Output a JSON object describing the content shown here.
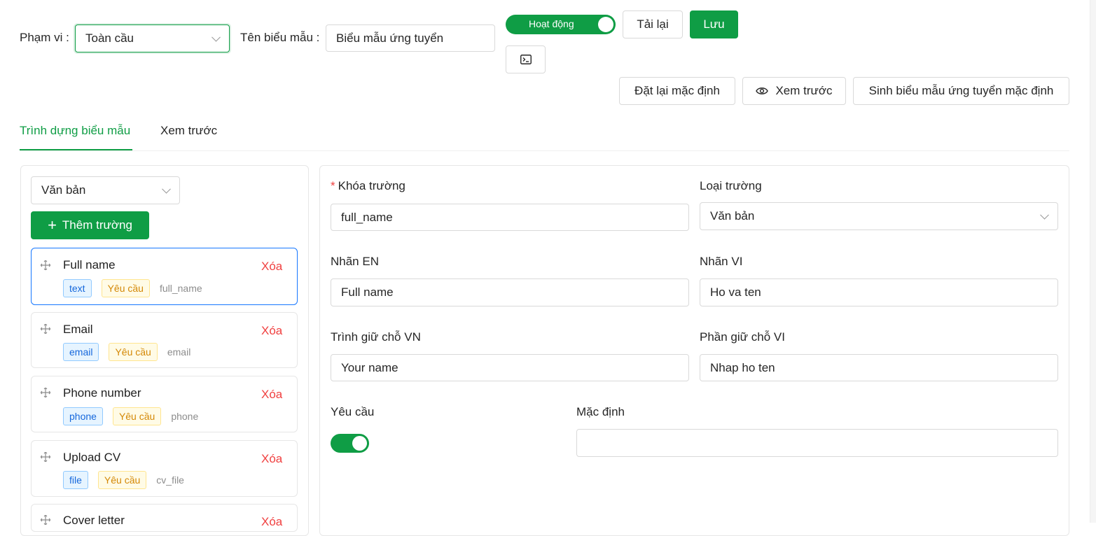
{
  "toolbar": {
    "scope_label": "Phạm vi",
    "scope_value": "Toàn cầu",
    "form_name_label": "Tên biểu mẫu",
    "form_name_value": "Biểu mẫu ứng tuyển",
    "active_label": "Hoạt động",
    "reload_label": "Tải lại",
    "save_label": "Lưu",
    "reset_label": "Đặt lại mặc định",
    "preview_label": "Xem trước",
    "generate_label": "Sinh biểu mẫu ứng tuyển mặc định",
    "terminal_icon": "terminal-icon"
  },
  "tabs": [
    {
      "label": "Trình dựng biểu mẫu",
      "active": true
    },
    {
      "label": "Xem trước",
      "active": false
    }
  ],
  "builder": {
    "field_type_select": "Văn bản",
    "add_field_label": "Thêm trường",
    "fields": [
      {
        "title": "Full name",
        "type": "text",
        "required": "Yêu cầu",
        "key": "full_name",
        "delete": "Xóa"
      },
      {
        "title": "Email",
        "type": "email",
        "required": "Yêu cầu",
        "key": "email",
        "delete": "Xóa"
      },
      {
        "title": "Phone number",
        "type": "phone",
        "required": "Yêu cầu",
        "key": "phone",
        "delete": "Xóa"
      },
      {
        "title": "Upload CV",
        "type": "file",
        "required": "Yêu cầu",
        "key": "cv_file",
        "delete": "Xóa"
      },
      {
        "title": "Cover letter",
        "type": "",
        "required": "",
        "key": "",
        "delete": "Xóa"
      }
    ]
  },
  "editor": {
    "field_key_label": "Khóa trường",
    "field_key_value": "full_name",
    "field_type_label": "Loại trường",
    "field_type_value": "Văn bản",
    "label_en_label": "Nhãn EN",
    "label_en_value": "Full name",
    "label_vi_label": "Nhãn VI",
    "label_vi_value": "Ho va ten",
    "placeholder_vn_label": "Trình giữ chỗ VN",
    "placeholder_vn_value": "Your name",
    "placeholder_vi_label": "Phần giữ chỗ VI",
    "placeholder_vi_value": "Nhap ho ten",
    "required_label": "Yêu cầu",
    "required_on": true,
    "default_label": "Mặc định",
    "default_value": ""
  },
  "colors": {
    "primary": "#0f9d45",
    "danger": "#f04040"
  }
}
